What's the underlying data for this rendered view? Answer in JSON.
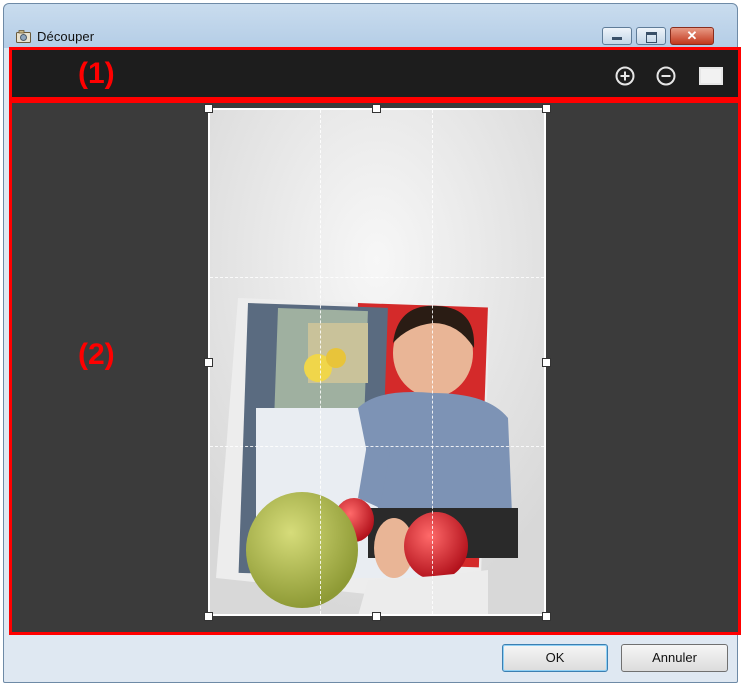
{
  "window": {
    "title": "Découper",
    "controls": {
      "close_glyph": "✕"
    }
  },
  "annotations": {
    "toolbar_label": "(1)",
    "canvas_label": "(2)",
    "highlight_color": "#ff0000"
  },
  "toolbar": {
    "tools": [
      {
        "name": "zoom-in",
        "icon": "zoom-in-icon"
      },
      {
        "name": "zoom-out",
        "icon": "zoom-out-icon"
      },
      {
        "name": "full-view",
        "icon": "full-view-icon"
      }
    ]
  },
  "footer": {
    "ok_label": "OK",
    "cancel_label": "Annuler"
  },
  "colors": {
    "toolbar_bg": "#1d1d1d",
    "canvas_bg": "#3b3b3b",
    "crop_frame": "#ffffff"
  }
}
